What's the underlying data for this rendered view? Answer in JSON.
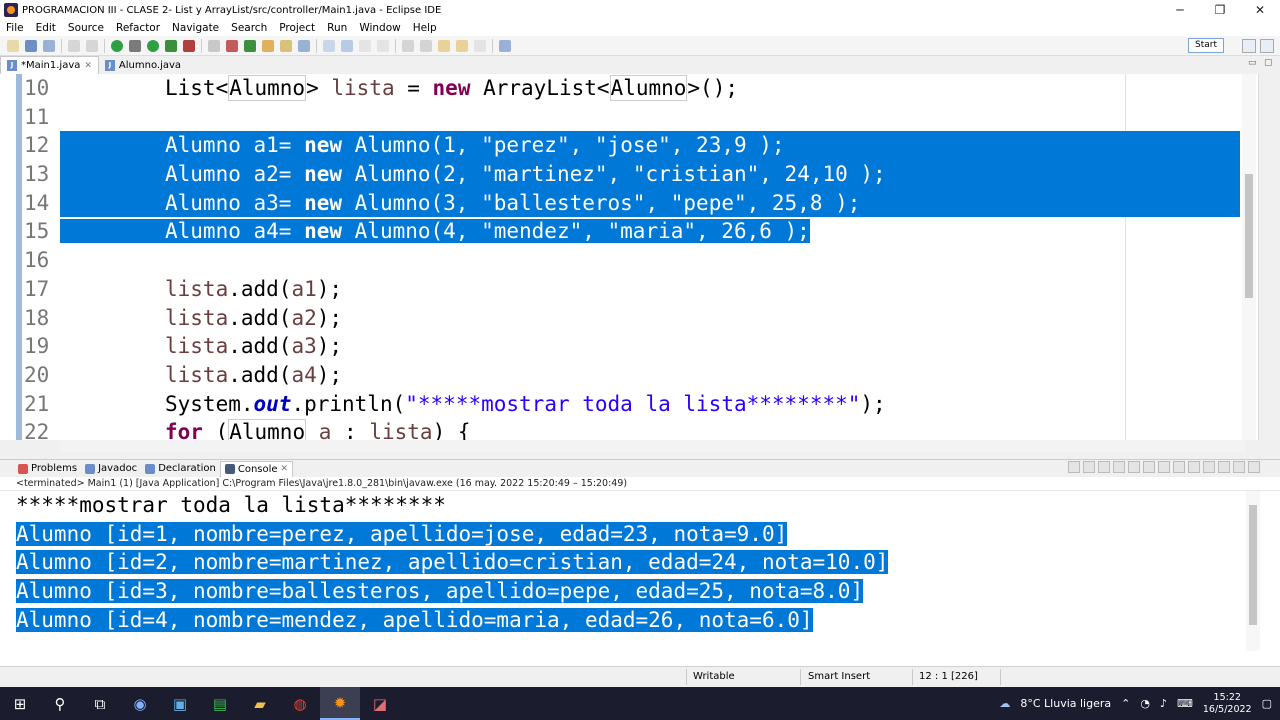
{
  "window": {
    "title": "PROGRAMACION III - CLASE 2- List y ArrayList/src/controller/Main1.java - Eclipse IDE",
    "minimize": "─",
    "restore": "❐",
    "close": "✕"
  },
  "menu": [
    "File",
    "Edit",
    "Source",
    "Refactor",
    "Navigate",
    "Search",
    "Project",
    "Run",
    "Window",
    "Help"
  ],
  "toolbar": {
    "start_label": "Start"
  },
  "editor_tabs": [
    {
      "label": "*Main1.java",
      "active": true
    },
    {
      "label": "Alumno.java",
      "active": false
    }
  ],
  "code": {
    "lines": [
      {
        "num": "10",
        "text": "List<Alumno> lista = new ArrayList<Alumno>();"
      },
      {
        "num": "11",
        "text": ""
      },
      {
        "num": "12",
        "text": "Alumno a1= new Alumno(1, \"perez\", \"jose\", 23,9 );"
      },
      {
        "num": "13",
        "text": "Alumno a2= new Alumno(2, \"martinez\", \"cristian\", 24,10 );"
      },
      {
        "num": "14",
        "text": "Alumno a3= new Alumno(3, \"ballesteros\", \"pepe\", 25,8 );"
      },
      {
        "num": "15",
        "text": "Alumno a4= new Alumno(4, \"mendez\", \"maria\", 26,6 );"
      },
      {
        "num": "16",
        "text": ""
      },
      {
        "num": "17",
        "text": "lista.add(a1);"
      },
      {
        "num": "18",
        "text": "lista.add(a2);"
      },
      {
        "num": "19",
        "text": "lista.add(a3);"
      },
      {
        "num": "20",
        "text": "lista.add(a4);"
      },
      {
        "num": "21",
        "text": "System.out.println(\"*****mostrar toda la lista********\");"
      },
      {
        "num": "22",
        "text": "for (Alumno a : lista) {"
      }
    ]
  },
  "console_tabs": [
    {
      "label": "Problems",
      "active": false
    },
    {
      "label": "Javadoc",
      "active": false
    },
    {
      "label": "Declaration",
      "active": false
    },
    {
      "label": "Console",
      "active": true
    }
  ],
  "console": {
    "terminated": "<terminated> Main1 (1) [Java Application] C:\\Program Files\\Java\\jre1.8.0_281\\bin\\javaw.exe  (16 may. 2022 15:20:49 – 15:20:49)",
    "output": [
      "*****mostrar toda la lista********",
      "Alumno [id=1, nombre=perez, apellido=jose, edad=23, nota=9.0]",
      "Alumno [id=2, nombre=martinez, apellido=cristian, edad=24, nota=10.0]",
      "Alumno [id=3, nombre=ballesteros, apellido=pepe, edad=25, nota=8.0]",
      "Alumno [id=4, nombre=mendez, apellido=maria, edad=26, nota=6.0]"
    ]
  },
  "status": {
    "writable": "Writable",
    "insert_mode": "Smart Insert",
    "position": "12 : 1 [226]"
  },
  "taskbar": {
    "weather": "8°C  Lluvia ligera",
    "time": "15:22",
    "date": "16/5/2022"
  }
}
